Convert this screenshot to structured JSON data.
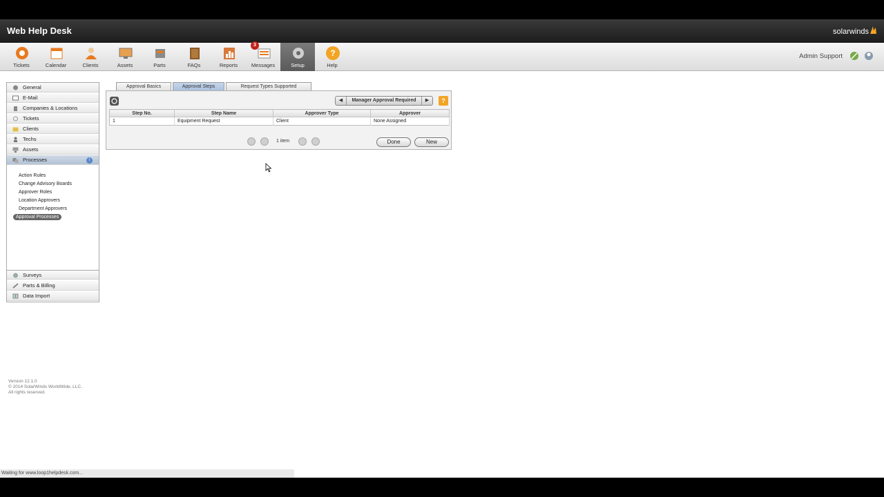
{
  "app": {
    "title": "Web Help Desk",
    "brand": "solarwinds"
  },
  "colors": {
    "accent": "#f2a424",
    "badge": "#c0231b",
    "selected": "#666666"
  },
  "toolbar": {
    "items": [
      {
        "label": "Tickets",
        "icon": "lifebuoy-icon"
      },
      {
        "label": "Calendar",
        "icon": "calendar-icon"
      },
      {
        "label": "Clients",
        "icon": "person-icon"
      },
      {
        "label": "Assets",
        "icon": "monitor-icon"
      },
      {
        "label": "Parts",
        "icon": "parts-icon"
      },
      {
        "label": "FAQs",
        "icon": "book-icon"
      },
      {
        "label": "Reports",
        "icon": "reports-icon"
      },
      {
        "label": "Messages",
        "icon": "messages-icon",
        "badge": "3"
      },
      {
        "label": "Setup",
        "icon": "gear-icon",
        "active": true
      },
      {
        "label": "Help",
        "icon": "help-icon"
      }
    ]
  },
  "user": {
    "name": "Admin Support"
  },
  "sidebar": {
    "items": [
      {
        "label": "General",
        "icon": "gear-icon"
      },
      {
        "label": "E-Mail",
        "icon": "mail-icon"
      },
      {
        "label": "Companies & Locations",
        "icon": "building-icon"
      },
      {
        "label": "Tickets",
        "icon": "ticket-icon"
      },
      {
        "label": "Clients",
        "icon": "folder-icon"
      },
      {
        "label": "Techs",
        "icon": "person-icon"
      },
      {
        "label": "Assets",
        "icon": "monitor-icon"
      },
      {
        "label": "Processes",
        "icon": "process-icon",
        "selected": true
      }
    ],
    "sub_items": [
      {
        "label": "Action Rules"
      },
      {
        "label": "Change Advisory Boards"
      },
      {
        "label": "Approver Roles"
      },
      {
        "label": "Location Approvers"
      },
      {
        "label": "Department Approvers"
      },
      {
        "label": "Approval Processes",
        "selected": true
      }
    ],
    "bottom_items": [
      {
        "label": "Surveys",
        "icon": "survey-icon"
      },
      {
        "label": "Parts & Billing",
        "icon": "billing-icon"
      },
      {
        "label": "Data Import",
        "icon": "import-icon"
      }
    ]
  },
  "footer": {
    "version": "Version 12.1.0",
    "copyright": "© 2014 SolarWinds WorldWide, LLC.",
    "rights": "All rights reserved."
  },
  "tabs": [
    {
      "label": "Approval Basics"
    },
    {
      "label": "Approval Steps",
      "active": true
    },
    {
      "label": "Request Types Supported"
    }
  ],
  "panel": {
    "nav_title": "Manager Approval Required",
    "help_label": "?",
    "columns": [
      "Step No.",
      "Step Name",
      "Approver Type",
      "Approver"
    ],
    "rows": [
      [
        "1",
        "Equipment Request",
        "Client",
        "None Assigned"
      ]
    ],
    "pager_text": "1 item",
    "done_label": "Done",
    "new_label": "New"
  },
  "status": {
    "text": "Waiting for www.loop1helpdesk.com..."
  }
}
